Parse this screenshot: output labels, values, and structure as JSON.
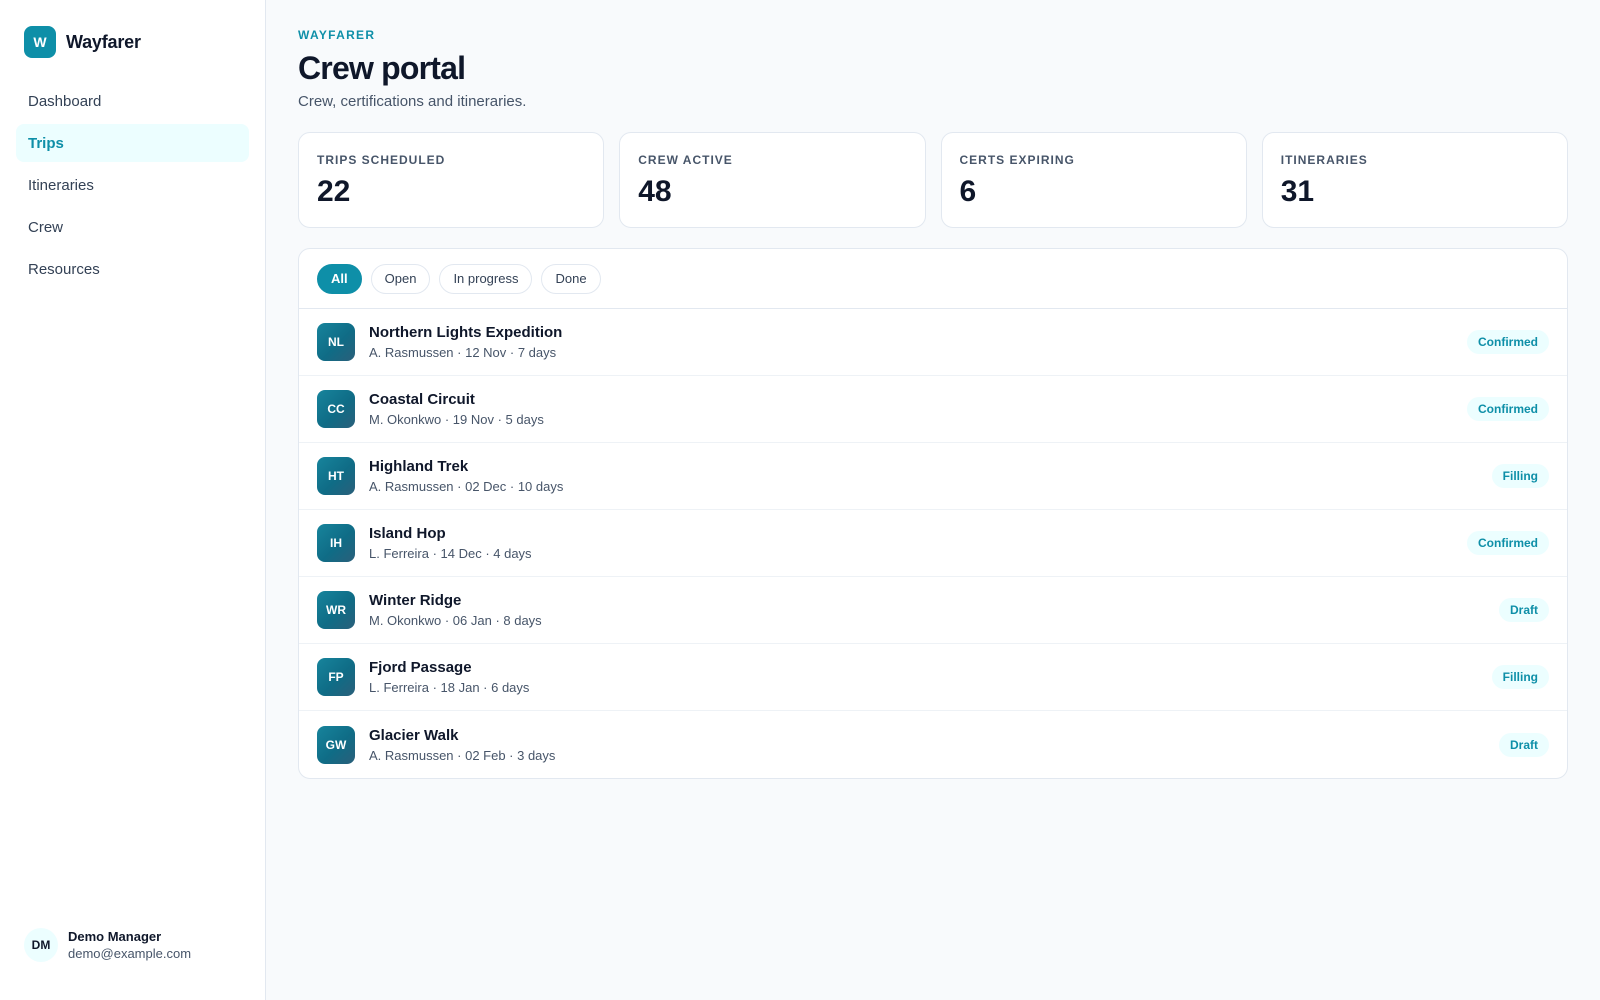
{
  "brand": {
    "logo_letter": "W",
    "name": "Wayfarer"
  },
  "nav": {
    "items": [
      {
        "label": "Dashboard",
        "active": false
      },
      {
        "label": "Trips",
        "active": true
      },
      {
        "label": "Itineraries",
        "active": false
      },
      {
        "label": "Crew",
        "active": false
      },
      {
        "label": "Resources",
        "active": false
      }
    ]
  },
  "user": {
    "initials": "DM",
    "name": "Demo Manager",
    "email": "demo@example.com"
  },
  "header": {
    "eyebrow": "WAYFARER",
    "title": "Crew portal",
    "subtitle": "Crew, certifications and itineraries."
  },
  "stats": [
    {
      "label": "TRIPS SCHEDULED",
      "value": "22"
    },
    {
      "label": "CREW ACTIVE",
      "value": "48"
    },
    {
      "label": "CERTS EXPIRING",
      "value": "6"
    },
    {
      "label": "ITINERARIES",
      "value": "31"
    }
  ],
  "filters": [
    {
      "label": "All",
      "active": true
    },
    {
      "label": "Open",
      "active": false
    },
    {
      "label": "In progress",
      "active": false
    },
    {
      "label": "Done",
      "active": false
    }
  ],
  "trips": [
    {
      "initials": "NL",
      "title": "Northern Lights Expedition",
      "meta": "A. Rasmussen · 12 Nov · 7 days",
      "status": "Confirmed"
    },
    {
      "initials": "CC",
      "title": "Coastal Circuit",
      "meta": "M. Okonkwo · 19 Nov · 5 days",
      "status": "Confirmed"
    },
    {
      "initials": "HT",
      "title": "Highland Trek",
      "meta": "A. Rasmussen · 02 Dec · 10 days",
      "status": "Filling"
    },
    {
      "initials": "IH",
      "title": "Island Hop",
      "meta": "L. Ferreira · 14 Dec · 4 days",
      "status": "Confirmed"
    },
    {
      "initials": "WR",
      "title": "Winter Ridge",
      "meta": "M. Okonkwo · 06 Jan · 8 days",
      "status": "Draft"
    },
    {
      "initials": "FP",
      "title": "Fjord Passage",
      "meta": "L. Ferreira · 18 Jan · 6 days",
      "status": "Filling"
    },
    {
      "initials": "GW",
      "title": "Glacier Walk",
      "meta": "A. Rasmussen · 02 Feb · 3 days",
      "status": "Draft"
    }
  ],
  "colors": {
    "accent": "#0e8fa8",
    "accent_soft": "#ecfeff",
    "text": "#0f172a",
    "muted": "#475569",
    "border": "#e2e8f0"
  }
}
